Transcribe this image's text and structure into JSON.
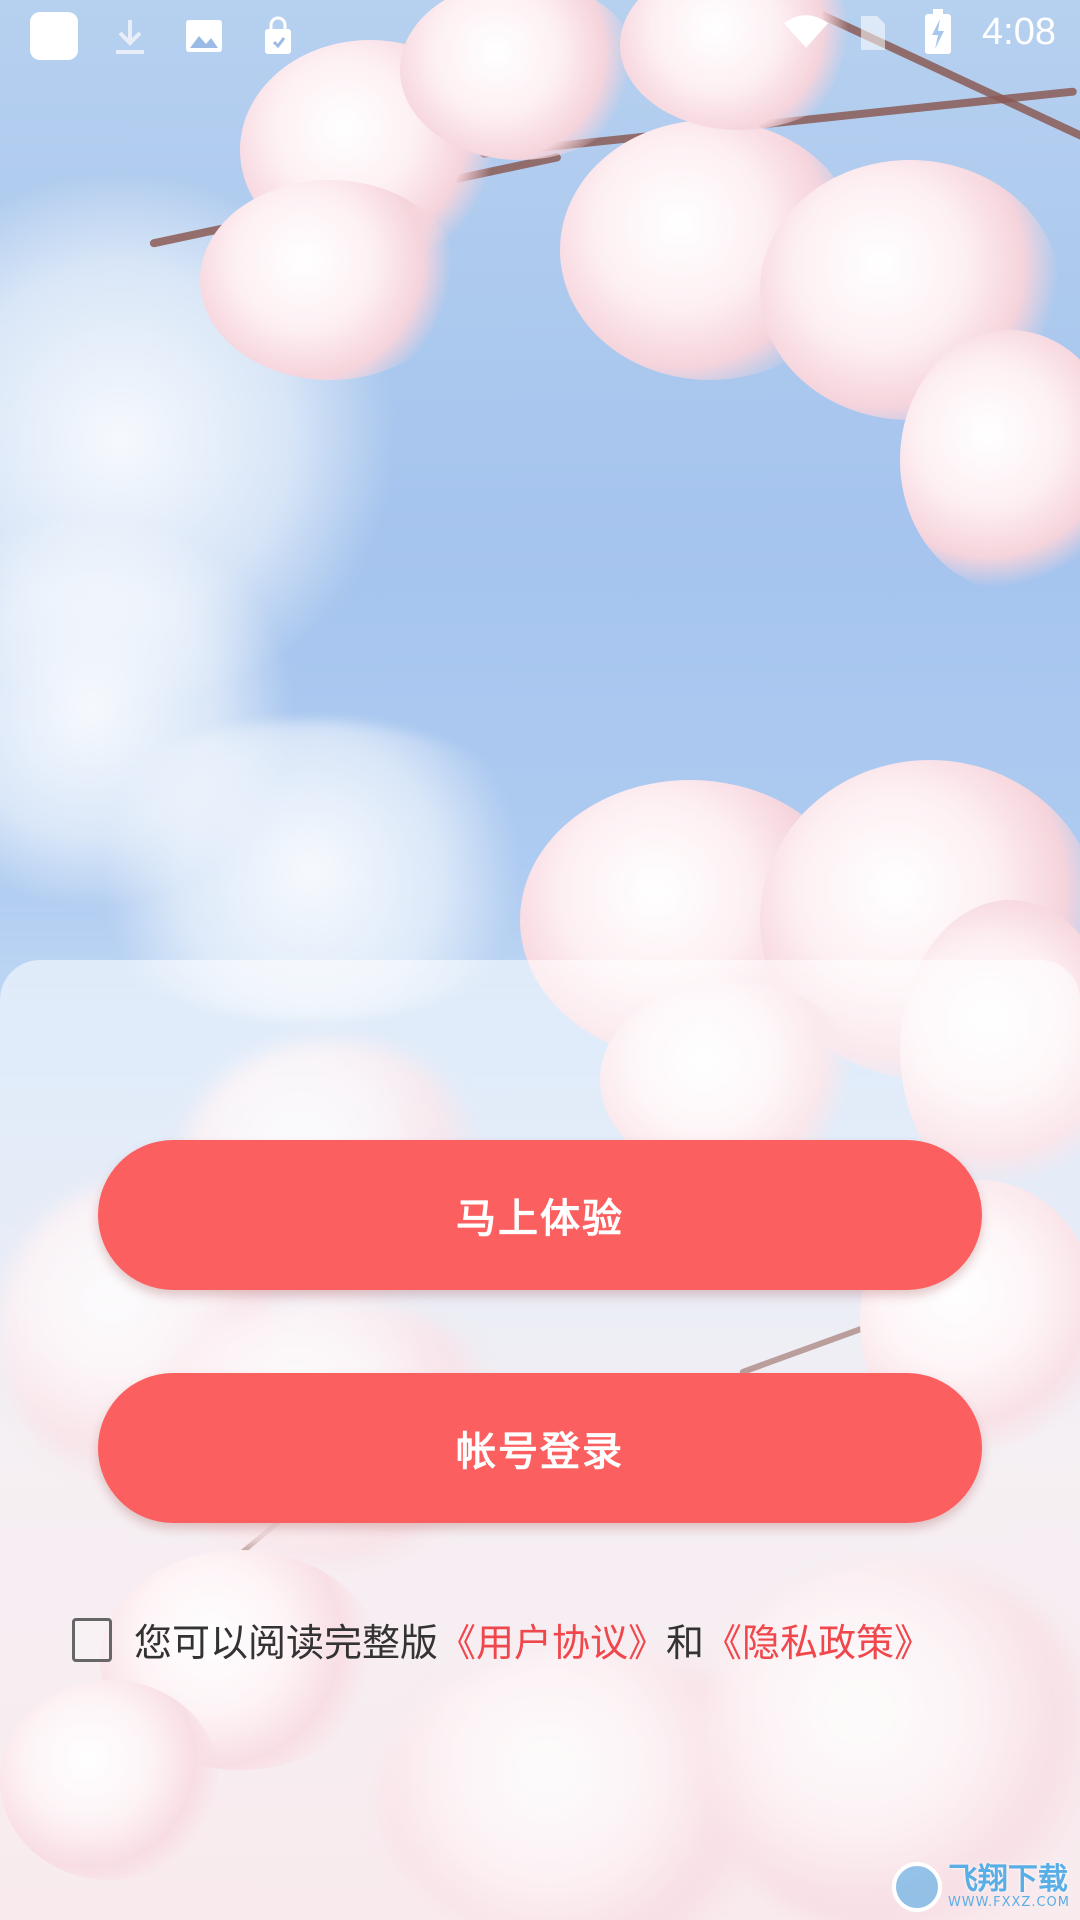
{
  "status_bar": {
    "time": "4:08",
    "icons": [
      "app-square-icon",
      "download-icon",
      "image-icon",
      "lock-bag-icon",
      "wifi-icon",
      "sim-icon",
      "battery-charging-icon"
    ]
  },
  "buttons": {
    "try_now": "马上体验",
    "account_login": "帐号登录"
  },
  "agreement": {
    "prefix": "您可以阅读完整版",
    "user_agreement": "《用户协议》",
    "conjunction": "和",
    "privacy_policy": "《隐私政策》"
  },
  "watermark": {
    "brand": "飞翔下载",
    "url": "WWW.FXXZ.COM"
  },
  "colors": {
    "accent": "#fc5f5f",
    "link": "#f0474c"
  }
}
